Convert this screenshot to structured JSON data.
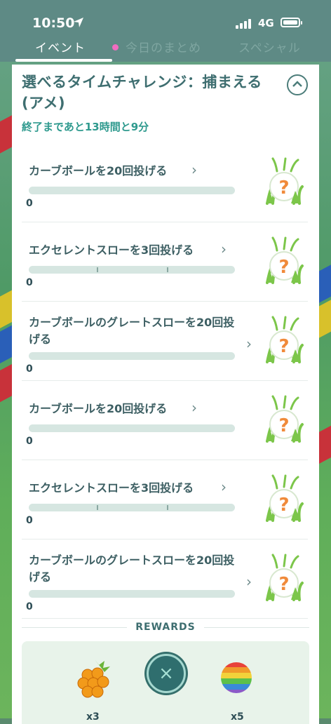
{
  "status_bar": {
    "time": "10:50",
    "network": "4G"
  },
  "tabs": [
    {
      "label": "イベント",
      "active": true
    },
    {
      "label": "今日のまとめ",
      "active": false,
      "dot_color": "#f06cc0"
    },
    {
      "label": "スペシャル",
      "active": false
    }
  ],
  "research": {
    "title": "選べるタイムチャレンジ：捕まえる(アメ)",
    "timer": "終了まであと13時間と9分"
  },
  "tasks": [
    {
      "label": "カーブボールを20回投げる",
      "progress": "0",
      "ticks": []
    },
    {
      "label": "エクセレントスローを3回投げる",
      "progress": "0",
      "ticks": [
        0.33,
        0.67
      ]
    },
    {
      "label": "カーブボールのグレートスローを20回投げる",
      "progress": "0",
      "ticks": []
    },
    {
      "label": "カーブボールを20回投げる",
      "progress": "0",
      "ticks": []
    },
    {
      "label": "エクセレントスローを3回投げる",
      "progress": "0",
      "ticks": [
        0.33,
        0.67
      ]
    },
    {
      "label": "カーブボールのグレートスローを20回投げる",
      "progress": "0",
      "ticks": []
    }
  ],
  "rewards": {
    "heading": "REWARDS",
    "items": [
      {
        "icon": "golden-razz-berry-icon",
        "count": "x3"
      },
      {
        "icon": "rare-candy-icon",
        "count": "x5"
      }
    ]
  },
  "colors": {
    "accent": "#2f9a8e",
    "header": "#5e8a85",
    "title": "#3e6e70"
  }
}
